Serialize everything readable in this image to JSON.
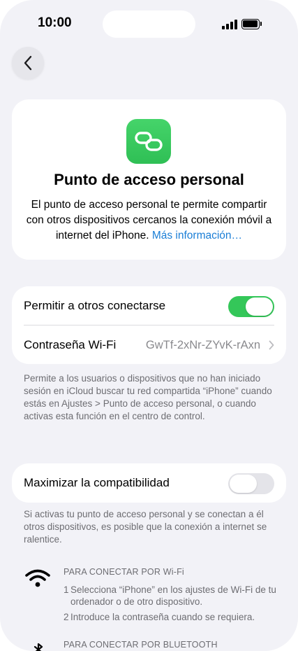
{
  "status_bar": {
    "time": "10:00"
  },
  "hero": {
    "title": "Punto de acceso personal",
    "description": "El punto de acceso personal te permite compartir con otros dispositivos cercanos la conexión móvil a internet del iPhone.",
    "link": "Más información…",
    "icon": "link-icon",
    "icon_color": "#34c759"
  },
  "settings": {
    "allow_others_label": "Permitir a otros conectarse",
    "allow_others_on": true,
    "wifi_password_label": "Contraseña Wi-Fi",
    "wifi_password_value": "GwTf-2xNr-ZYvK-rAxn"
  },
  "allow_footnote": "Permite a los usuarios o dispositivos que no han iniciado sesión en iCloud buscar tu red compartida “iPhone” cuando estás en Ajustes > Punto de acceso personal, o cuando activas esta función en el centro de control.",
  "compatibility": {
    "label": "Maximizar la compatibilidad",
    "on": false,
    "footnote": "Si activas tu punto de acceso personal y se conectan a él otros dispositivos, es posible que la conexión a internet se ralentice."
  },
  "connect_wifi": {
    "heading": "PARA CONECTAR POR Wi-Fi",
    "steps": [
      {
        "num": "1",
        "text": "Selecciona “iPhone” en los ajustes de Wi-Fi de tu ordenador o de otro dispositivo."
      },
      {
        "num": "2",
        "text": "Introduce la contraseña cuando se requiera."
      }
    ]
  },
  "connect_bluetooth": {
    "heading": "PARA CONECTAR POR BLUETOOTH"
  },
  "colors": {
    "toggle_on": "#34c759",
    "link": "#1a7ed6",
    "background": "#f2f2f7"
  }
}
